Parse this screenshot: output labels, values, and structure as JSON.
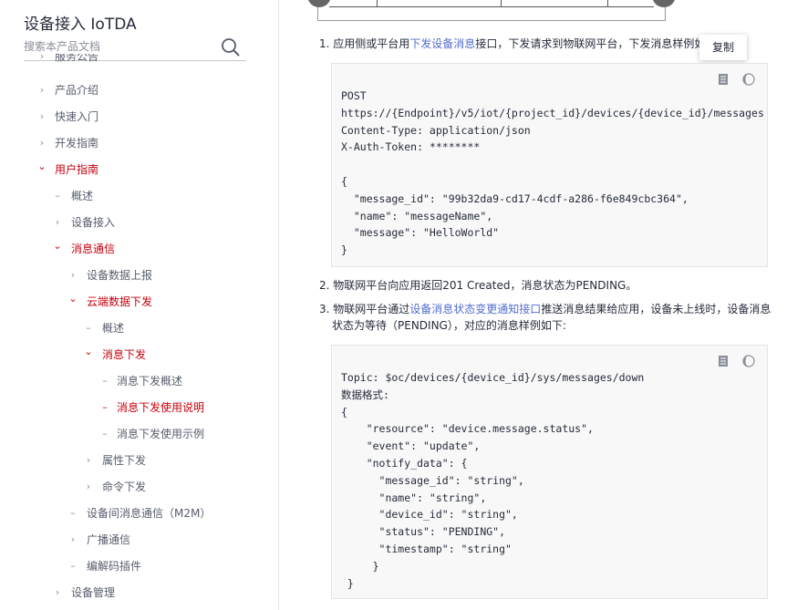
{
  "sidebar": {
    "title": "设备接入 IoTDA",
    "search_placeholder": "搜索本产品文档",
    "items": [
      {
        "label": "服务公告",
        "icon": "chevron-right-icon",
        "glyph": "›",
        "active": false
      },
      {
        "label": "产品介绍",
        "icon": "chevron-right-icon",
        "glyph": "›",
        "active": false
      },
      {
        "label": "快速入门",
        "icon": "chevron-right-icon",
        "glyph": "›",
        "active": false
      },
      {
        "label": "开发指南",
        "icon": "chevron-right-icon",
        "glyph": "›",
        "active": false
      },
      {
        "label": "用户指南",
        "icon": "chevron-down-icon",
        "glyph": "⌄",
        "active": true
      },
      {
        "label": "概述",
        "icon": "dash-icon",
        "glyph": "–",
        "active": false
      },
      {
        "label": "设备接入",
        "icon": "chevron-right-icon",
        "glyph": "›",
        "active": false
      },
      {
        "label": "消息通信",
        "icon": "chevron-down-icon",
        "glyph": "⌄",
        "active": true
      },
      {
        "label": "设备数据上报",
        "icon": "chevron-right-icon",
        "glyph": "›",
        "active": false
      },
      {
        "label": "云端数据下发",
        "icon": "chevron-down-icon",
        "glyph": "⌄",
        "active": true
      },
      {
        "label": "概述",
        "icon": "dash-icon",
        "glyph": "–",
        "active": false
      },
      {
        "label": "消息下发",
        "icon": "chevron-down-icon",
        "glyph": "⌄",
        "active": true
      },
      {
        "label": "消息下发概述",
        "icon": "dash-icon",
        "glyph": "–",
        "active": false
      },
      {
        "label": "消息下发使用说明",
        "icon": "dash-icon",
        "glyph": "–",
        "active": true
      },
      {
        "label": "消息下发使用示例",
        "icon": "dash-icon",
        "glyph": "–",
        "active": false
      },
      {
        "label": "属性下发",
        "icon": "chevron-right-icon",
        "glyph": "›",
        "active": false
      },
      {
        "label": "命令下发",
        "icon": "chevron-right-icon",
        "glyph": "›",
        "active": false
      },
      {
        "label": "设备间消息通信（M2M）",
        "icon": "dash-icon",
        "glyph": "–",
        "active": false
      },
      {
        "label": "广播通信",
        "icon": "chevron-right-icon",
        "glyph": "›",
        "active": false
      },
      {
        "label": "编解码插件",
        "icon": "dash-icon",
        "glyph": "–",
        "active": false
      },
      {
        "label": "设备管理",
        "icon": "chevron-right-icon",
        "glyph": "›",
        "active": false
      }
    ]
  },
  "main": {
    "step1": {
      "num": "1.",
      "text_a": "应用侧或平台用",
      "link": "下发设备消息",
      "text_b": "接口，下发请求到物联网平台，下发消息样例如"
    },
    "tooltip": "复制",
    "code1": "POST\nhttps://{Endpoint}/v5/iot/{project_id}/devices/{device_id}/messages\nContent-Type: application/json\nX-Auth-Token: ********\n\n{\n  \"message_id\": \"99b32da9-cd17-4cdf-a286-f6e849cbc364\",\n  \"name\": \"messageName\",\n  \"message\": \"HelloWorld\"\n}",
    "step2": {
      "num": "2.",
      "text": "物联网平台向应用返回201 Created，消息状态为PENDING。"
    },
    "step3": {
      "num": "3.",
      "text_a": "物联网平台通过",
      "link": "设备消息状态变更通知接口",
      "text_b": "推送消息结果给应用，设备未上线时，设备消息",
      "text_c": "状态为等待（PENDING），对应的消息样例如下:"
    },
    "code2": "Topic: $oc/devices/{device_id}/sys/messages/down\n数据格式:\n{\n    \"resource\": \"device.message.status\",\n    \"event\": \"update\",\n    \"notify_data\": {\n      \"message_id\": \"string\",\n      \"name\": \"string\",\n      \"device_id\": \"string\",\n      \"status\": \"PENDING\",\n      \"timestamp\": \"string\"\n     }\n }",
    "code_icons": [
      "copy-icon",
      "theme-toggle-icon"
    ]
  },
  "colors": {
    "accent_red": "#c7000b",
    "link_blue": "#526ecc",
    "text": "#252b3a",
    "muted": "#575d6c",
    "code_bg": "#f8f8f8"
  }
}
